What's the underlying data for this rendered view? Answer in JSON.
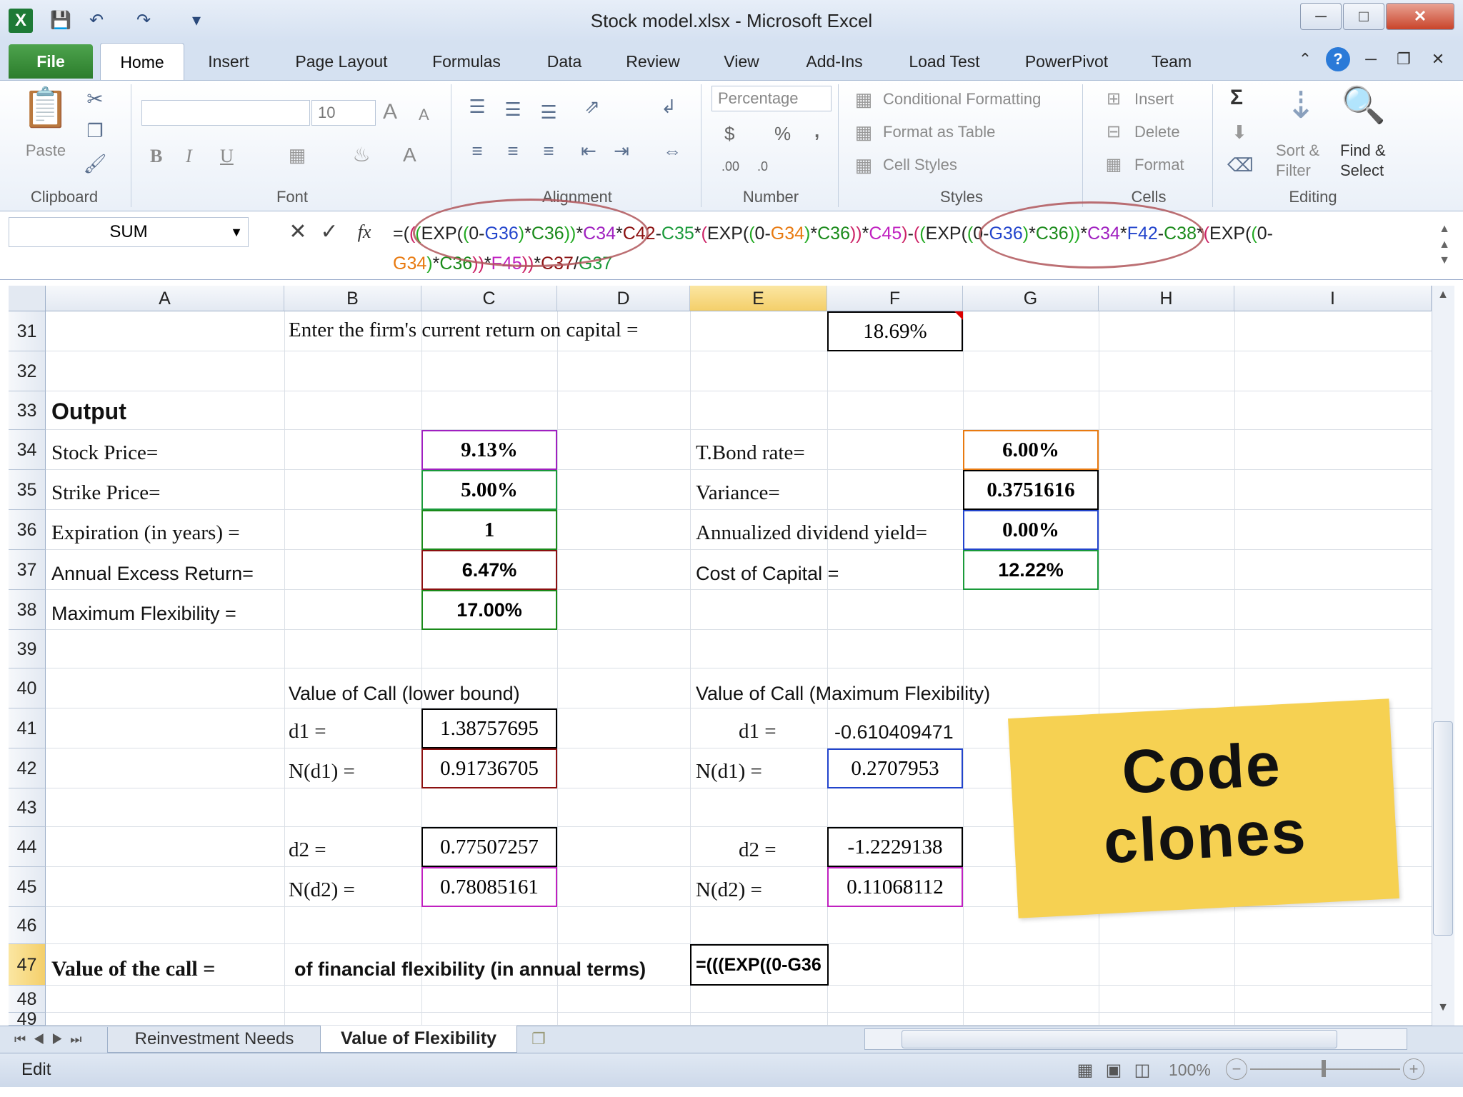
{
  "window": {
    "title": "Stock model.xlsx - Microsoft Excel",
    "controls": [
      "minimize-icon",
      "restore-icon",
      "close-icon"
    ]
  },
  "ribbon": {
    "tabs": [
      "File",
      "Home",
      "Insert",
      "Page Layout",
      "Formulas",
      "Data",
      "Review",
      "View",
      "Add-Ins",
      "Load Test",
      "PowerPivot",
      "Team"
    ],
    "clipboard": {
      "paste": "Paste",
      "label": "Clipboard"
    },
    "font": {
      "name": "",
      "size": "10",
      "bold": "B",
      "italic": "I",
      "underline": "U",
      "grow": "A",
      "shrink": "A",
      "color": "A",
      "label": "Font"
    },
    "alignment": {
      "label": "Alignment"
    },
    "number": {
      "format": "Percentage",
      "currency": "$",
      "percent": "%",
      "comma": ",",
      "inc": ".00",
      "dec": ".0",
      "label": "Number"
    },
    "styles": {
      "conditional": "Conditional Formatting",
      "table": "Format as Table",
      "cell": "Cell Styles",
      "label": "Styles"
    },
    "cells": {
      "insert": "Insert",
      "delete": "Delete",
      "format": "Format",
      "label": "Cells"
    },
    "editing": {
      "sum": "Σ",
      "sort": "Sort &",
      "filter": "Filter",
      "find": "Find &",
      "select": "Select",
      "label": "Editing"
    }
  },
  "formula_bar": {
    "name_box": "SUM",
    "fx": "fx",
    "formula_parts": [
      {
        "t": "=(",
        "c": "#222"
      },
      {
        "t": "(",
        "c": "#c26"
      },
      {
        "t": "(",
        "c": "#2a2"
      },
      {
        "t": "EXP(",
        "c": "#222"
      },
      {
        "t": "(",
        "c": "#2a2"
      },
      {
        "t": "0-",
        "c": "#222"
      },
      {
        "t": "G36",
        "c": "#2244cc"
      },
      {
        "t": ")",
        "c": "#2a2"
      },
      {
        "t": "*",
        "c": "#222"
      },
      {
        "t": "C36",
        "c": "#1a8a1a"
      },
      {
        "t": "))",
        "c": "#2a2"
      },
      {
        "t": "*",
        "c": "#222"
      },
      {
        "t": "C34",
        "c": "#a020c0"
      },
      {
        "t": "*",
        "c": "#222"
      },
      {
        "t": "C42",
        "c": "#8b1010"
      },
      {
        "t": "-",
        "c": "#222"
      },
      {
        "t": "C35",
        "c": "#1a9a3a"
      },
      {
        "t": "*",
        "c": "#222"
      },
      {
        "t": "(",
        "c": "#c26"
      },
      {
        "t": "EXP(",
        "c": "#222"
      },
      {
        "t": "(",
        "c": "#2a2"
      },
      {
        "t": "0-",
        "c": "#222"
      },
      {
        "t": "G34",
        "c": "#e87a10"
      },
      {
        "t": ")",
        "c": "#2a2"
      },
      {
        "t": "*",
        "c": "#222"
      },
      {
        "t": "C36",
        "c": "#1a8a1a"
      },
      {
        "t": "))",
        "c": "#c26"
      },
      {
        "t": "*",
        "c": "#222"
      },
      {
        "t": "C45",
        "c": "#c020c0"
      },
      {
        "t": ")",
        "c": "#c26"
      },
      {
        "t": "-",
        "c": "#222"
      },
      {
        "t": "(",
        "c": "#c26"
      },
      {
        "t": "(",
        "c": "#2a2"
      },
      {
        "t": "EXP(",
        "c": "#222"
      },
      {
        "t": "(",
        "c": "#2a2"
      },
      {
        "t": "0-",
        "c": "#222"
      },
      {
        "t": "G36",
        "c": "#2244cc"
      },
      {
        "t": ")",
        "c": "#2a2"
      },
      {
        "t": "*",
        "c": "#222"
      },
      {
        "t": "C36",
        "c": "#1a8a1a"
      },
      {
        "t": "))",
        "c": "#2a2"
      },
      {
        "t": "*",
        "c": "#222"
      },
      {
        "t": "C34",
        "c": "#a020c0"
      },
      {
        "t": "*",
        "c": "#222"
      },
      {
        "t": "F42",
        "c": "#2244cc"
      },
      {
        "t": "-",
        "c": "#222"
      },
      {
        "t": "C38",
        "c": "#1a8a1a"
      },
      {
        "t": "*",
        "c": "#222"
      },
      {
        "t": "(",
        "c": "#c26"
      },
      {
        "t": "EXP(",
        "c": "#222"
      },
      {
        "t": "(",
        "c": "#2a2"
      },
      {
        "t": "0-",
        "c": "#222"
      },
      {
        "t": "G34",
        "c": "#e87a10"
      },
      {
        "t": ")",
        "c": "#2a2"
      },
      {
        "t": "*",
        "c": "#222"
      },
      {
        "t": "C36",
        "c": "#1a8a1a"
      },
      {
        "t": "))",
        "c": "#c26"
      },
      {
        "t": "*",
        "c": "#222"
      },
      {
        "t": "F45",
        "c": "#c020c0"
      },
      {
        "t": "))",
        "c": "#c26"
      },
      {
        "t": "*",
        "c": "#222"
      },
      {
        "t": "C37",
        "c": "#8b1010"
      },
      {
        "t": "/",
        "c": "#222"
      },
      {
        "t": "G37",
        "c": "#1a9a3a"
      }
    ]
  },
  "grid": {
    "columns": [
      "A",
      "B",
      "C",
      "D",
      "E",
      "F",
      "G",
      "H",
      "I"
    ],
    "rows": [
      "31",
      "32",
      "33",
      "34",
      "35",
      "36",
      "37",
      "38",
      "39",
      "40",
      "41",
      "42",
      "43",
      "44",
      "45",
      "46",
      "47",
      "48",
      "49"
    ],
    "cells": {
      "B31": "Enter the firm's current return on capital =",
      "F31": "18.69%",
      "A33": "Output",
      "A34": "Stock Price=",
      "C34": "9.13%",
      "E34": "T.Bond rate=",
      "G34": "6.00%",
      "A35": "Strike Price=",
      "C35": "5.00%",
      "E35": "Variance=",
      "G35": "0.3751616",
      "A36": "Expiration (in years) =",
      "C36": "1",
      "E36": "Annualized dividend yield=",
      "G36": "0.00%",
      "A37": "Annual Excess Return=",
      "C37": "6.47%",
      "E37": "Cost of Capital =",
      "G37": "12.22%",
      "A38": "Maximum Flexibility =",
      "C38": "17.00%",
      "B40": "Value of Call (lower bound)",
      "E40": "Value of Call (Maximum Flexibility)",
      "B41": "d1 =",
      "C41": "1.38757695",
      "E41": "d1 =",
      "F41": "-0.610409471",
      "B42": "N(d1) =",
      "C42": "0.91736705",
      "E42": "N(d1) =",
      "F42": "0.2707953",
      "B44": "d2 =",
      "C44": "0.77507257",
      "E44": "d2 =",
      "F44": "-1.2229138",
      "B45": "N(d2) =",
      "C45": "0.78085161",
      "E45": "N(d2) =",
      "F45": "0.11068112",
      "A47": "Value of the call =",
      "B47": "of financial flexibility (in annual terms)",
      "E47": "=(((EXP((0-G36"
    }
  },
  "sheet_tabs": [
    "Reinvestment Needs",
    "Value of Flexibility"
  ],
  "status": {
    "mode": "Edit",
    "zoom": "100%"
  },
  "sticky_note": {
    "line1": "Code",
    "line2": "clones",
    "color": "#f6d152"
  }
}
